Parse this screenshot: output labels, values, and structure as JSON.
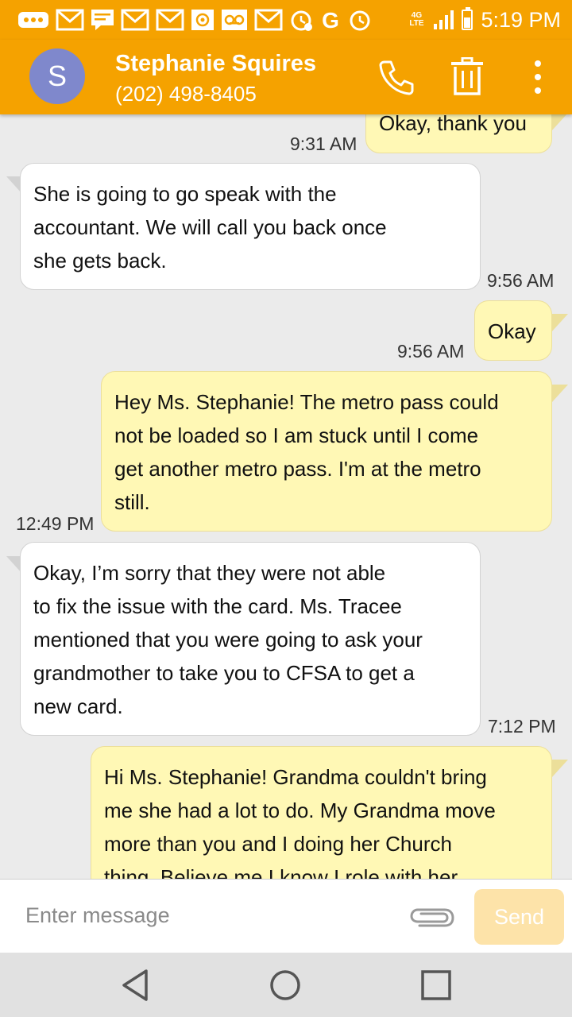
{
  "status_bar": {
    "time": "5:19 PM",
    "network_label": "4G LTE",
    "icons": [
      "more-icon",
      "gmail-icon",
      "message-icon",
      "gmail-icon",
      "gmail-icon",
      "email-icon",
      "voicemail-icon",
      "gmail-icon",
      "alarm-icon",
      "google-icon",
      "alarm-icon",
      "signal-icon",
      "battery-icon"
    ]
  },
  "header": {
    "avatar_letter": "S",
    "contact_name": "Stephanie Squires",
    "phone": "(202) 498-8405",
    "avatar_color": "#7f88cc",
    "bar_color": "#f5a200"
  },
  "messages": [
    {
      "direction": "outgoing",
      "text": "Okay, thank you",
      "time": "9:31 AM"
    },
    {
      "direction": "incoming",
      "lines": [
        "She is going to go speak with the",
        "accountant. We will call you back once",
        "she gets back."
      ],
      "time": "9:56 AM"
    },
    {
      "direction": "outgoing",
      "text": "Okay",
      "time": "9:56 AM"
    },
    {
      "direction": "outgoing",
      "lines": [
        "Hey Ms. Stephanie! The metro pass could",
        "not be loaded so I am stuck until I come",
        "get another metro pass. I'm at the metro",
        "still."
      ],
      "time": "12:49 PM"
    },
    {
      "direction": "incoming",
      "lines": [
        "Okay, I’m sorry that they were not able",
        "to fix the issue with the card. Ms. Tracee",
        "mentioned that you were going to ask your",
        "grandmother to take you to CFSA to get a",
        "new card."
      ],
      "time": "7:12 PM"
    },
    {
      "direction": "outgoing",
      "lines": [
        "Hi Ms. Stephanie! Grandma couldn't bring",
        "me she had a lot to do. My Grandma move",
        "more than you and I doing her Church",
        "thing. Believe me I know I role with her"
      ]
    }
  ],
  "composer": {
    "placeholder": "Enter message",
    "value": "",
    "send_label": "Send"
  },
  "nav": [
    "back",
    "home",
    "recents"
  ]
}
